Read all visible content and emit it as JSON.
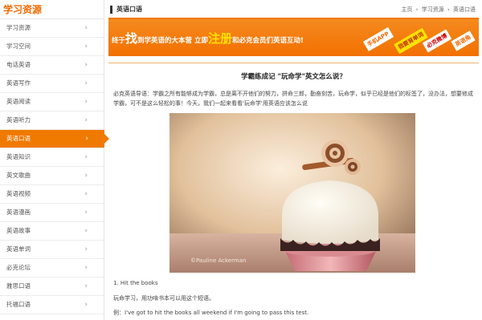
{
  "sidebar": {
    "title": "学习资源",
    "items": [
      {
        "label": "学习资源"
      },
      {
        "label": "学习空间"
      },
      {
        "label": "电话英语"
      },
      {
        "label": "英语写作"
      },
      {
        "label": "英语阅读"
      },
      {
        "label": "英语听力"
      },
      {
        "label": "英语口语"
      },
      {
        "label": "英语知识"
      },
      {
        "label": "英文歌曲"
      },
      {
        "label": "英语视频"
      },
      {
        "label": "英语漫画"
      },
      {
        "label": "英语故事"
      },
      {
        "label": "英语单词"
      },
      {
        "label": "必克论坛"
      },
      {
        "label": "雅思口语"
      },
      {
        "label": "托福口语"
      },
      {
        "label": "BEC口语"
      }
    ],
    "active_label": "英语口语"
  },
  "header": {
    "title": "英语口语",
    "breadcrumb": [
      "主页",
      "学习资源",
      "英语口语"
    ],
    "separator": "›"
  },
  "banner": {
    "part1": "终于",
    "big1": "找",
    "part2": "到学英语的大本营 立即",
    "big2": "注册",
    "part3": "和必克会员们英语互动!",
    "tags": [
      "手机APP",
      "我要背单词",
      "必克微博",
      "英语角"
    ]
  },
  "article": {
    "title": "学霸练成记 \"玩命学\"英文怎么说？",
    "intro": "必克英语导语：学霸之所有能够成为学霸，总是离不开他们的努力，拼命三郎，勤奋刻苦，玩命学，似乎已经是他们的标签了，没办法，想要修成学霸，可不是这么轻松的事！今天，我们一起来看看'玩命学'用英语应该怎么说",
    "photo_watermark": "©Pauline Ackerman",
    "example_heading": "1. Hit the books",
    "example_text": "玩命学习，用功啃书本可以用这个短语。",
    "example_label": "例：",
    "example_sentence": "I've got to hit the books all weekend if I'm going to pass this test."
  },
  "colors": {
    "accent": "#f07a00",
    "banner_yellow": "#ffe200"
  }
}
